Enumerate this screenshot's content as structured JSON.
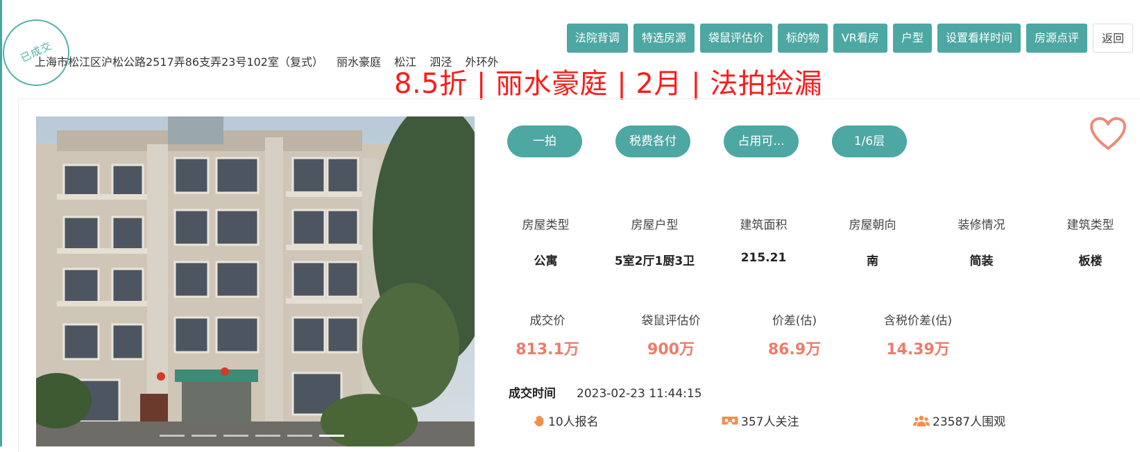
{
  "stamp": {
    "text": "已成交"
  },
  "address": {
    "full": "上海市松江区沪松公路2517弄86支弄23号102室（复式）",
    "tags": [
      "丽水豪庭",
      "松江",
      "泗泾",
      "外环外"
    ]
  },
  "headline": "8.5折 | 丽水豪庭 | 2月 | 法拍捡漏",
  "nav": {
    "buttons": [
      "法院背调",
      "特选房源",
      "袋鼠评估价",
      "标的物",
      "VR看房",
      "户型",
      "设置看样时间",
      "房源点评"
    ],
    "back": "返回"
  },
  "tags": [
    "一拍",
    "税费各付",
    "占用可...",
    "1/6层"
  ],
  "attributes": [
    {
      "label": "房屋类型",
      "value": "公寓"
    },
    {
      "label": "房屋户型",
      "value": "5室2厅1厨3卫"
    },
    {
      "label": "建筑面积",
      "value": "215.21"
    },
    {
      "label": "房屋朝向",
      "value": "南"
    },
    {
      "label": "装修情况",
      "value": "简装"
    },
    {
      "label": "建筑类型",
      "value": "板楼"
    }
  ],
  "prices": [
    {
      "label": "成交价",
      "value": "813.1万"
    },
    {
      "label": "袋鼠评估价",
      "value": "900万"
    },
    {
      "label": "价差(估)",
      "value": "86.9万"
    },
    {
      "label": "含税价差(估)",
      "value": "14.39万"
    }
  ],
  "deal": {
    "label": "成交时间",
    "time": "2023-02-23 11:44:15"
  },
  "stats": {
    "signups": "10人报名",
    "follows": "357人关注",
    "views": "23587人围观"
  },
  "colors": {
    "accent": "#4da7a3",
    "headline": "#ff1a1a",
    "price": "#ec7b6b",
    "heart": "#ee8a7a"
  },
  "icons": [
    "hand-icon",
    "vr-glasses-icon",
    "group-icon",
    "heart-icon"
  ],
  "photo": {
    "slide_count": 6,
    "active_slide": 6
  }
}
